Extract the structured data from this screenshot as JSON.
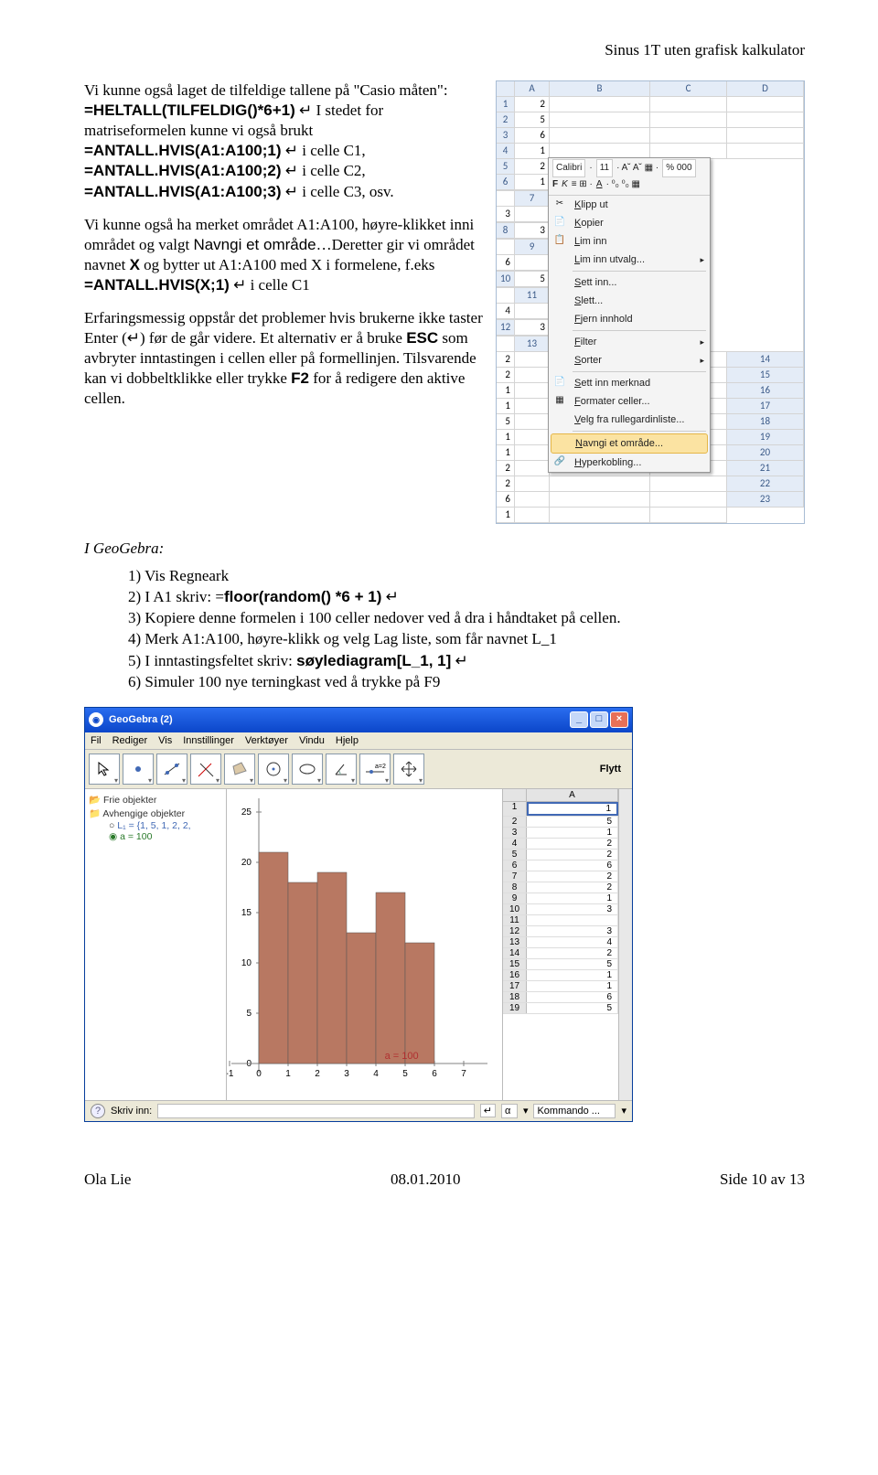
{
  "header": {
    "title": "Sinus 1T uten grafisk kalkulator"
  },
  "par1": {
    "a": "Vi kunne også laget de tilfeldige tallene på \"Casio måten\": ",
    "b": "=HELTALL(TILFELDIG()*6+1)",
    "c": " ↵",
    "d": "I stedet for matriseformelen kunne vi også brukt ",
    "e": "=ANTALL.HVIS(A1:A100;1)",
    "f": " ↵ i celle C1, ",
    "g": "=ANTALL.HVIS(A1:A100;2)",
    "h": " ↵ i celle C2, ",
    "i": "=ANTALL.HVIS(A1:A100;3)",
    "j": " ↵ i celle C3, osv."
  },
  "par2": {
    "a": "Vi kunne også ha merket området A1:A100, høyre-klikket inni området og valgt ",
    "b": "Navngi et område",
    "c": "…Deretter gir vi området navnet ",
    "d": "X",
    "e": " og bytter ut A1:A100 med X i formelene, f.eks ",
    "f": "=ANTALL.HVIS(X;1)",
    "g": " ↵ i celle C1"
  },
  "par3": {
    "a": "Erfaringsmessig oppstår det problemer hvis brukerne ikke taster Enter (↵) før de går videre. Et alternativ er å bruke ",
    "b": "ESC",
    "c": " som avbryter inntastingen i cellen eller på formellinjen. Tilsvarende kan vi dobbeltklikke eller trykke ",
    "d": "F2",
    "e": " for å redigere den aktive cellen."
  },
  "excel": {
    "cols": [
      "A",
      "B",
      "C",
      "D"
    ],
    "vals": [
      "2",
      "5",
      "6",
      "1",
      "2",
      "1",
      "3",
      "3",
      "6",
      "5",
      "4",
      "3",
      "2",
      "2",
      "1",
      "1",
      "5",
      "1",
      "1",
      "2",
      "2",
      "6",
      "1"
    ],
    "mini": {
      "font": "Calibri",
      "size": "11",
      "fmt": "% 000"
    },
    "menu": [
      "Klipp ut",
      "Kopier",
      "Lim inn",
      "Lim inn utvalg...",
      "Sett inn...",
      "Slett...",
      "Fjern innhold",
      "Filter",
      "Sorter",
      "Sett inn merknad",
      "Formater celler...",
      "Velg fra rullegardinliste...",
      "Navngi et område...",
      "Hyperkobling..."
    ]
  },
  "geo_h": "I GeoGebra:",
  "geo": [
    {
      "n": "1)",
      "a": "Vis Regneark"
    },
    {
      "n": "2)",
      "a": "I A1 skriv: =",
      "b": "floor(random() *6 + 1)",
      "c": " ↵"
    },
    {
      "n": "3)",
      "a": "Kopiere denne formelen i 100 celler nedover ved å dra i håndtaket på cellen."
    },
    {
      "n": "4)",
      "a": "Merk A1:A100, høyre-klikk og velg Lag liste, som får navnet L_1"
    },
    {
      "n": "5)",
      "a": "I inntastingsfeltet skriv: ",
      "b": "søylediagram[L_1, 1]",
      "c": " ↵"
    },
    {
      "n": "6)",
      "a": "Simuler 100 nye terningkast ved å trykke på F9"
    }
  ],
  "gg": {
    "title": "GeoGebra (2)",
    "menu": [
      "Fil",
      "Rediger",
      "Vis",
      "Innstillinger",
      "Verktøyer",
      "Vindu",
      "Hjelp"
    ],
    "flytt": "Flytt",
    "tree": {
      "f1": "Frie objekter",
      "f2": "Avhengige objekter",
      "l1": "L₁ = {1, 5, 1, 2, 2, ",
      "l2": "a = 100"
    },
    "axis_y": [
      "25",
      "20",
      "15",
      "10",
      "5",
      "0"
    ],
    "axis_x": [
      "-1",
      "0",
      "1",
      "2",
      "3",
      "4",
      "5",
      "6",
      "7"
    ],
    "ann": "a = 100",
    "sheet": {
      "col": "A",
      "vals": [
        "1",
        "5",
        "1",
        "2",
        "2",
        "6",
        "2",
        "2",
        "1",
        "3",
        "",
        "3",
        "4",
        "2",
        "5",
        "1",
        "1",
        "6",
        "5"
      ]
    },
    "status": {
      "lbl": "Skriv inn:",
      "alpha": "α",
      "cmd": "Kommando ..."
    }
  },
  "chart_data": {
    "type": "bar",
    "categories": [
      "1",
      "2",
      "3",
      "4",
      "5",
      "6"
    ],
    "values": [
      21,
      18,
      19,
      13,
      17,
      12
    ],
    "title": "",
    "xlabel": "",
    "ylabel": "",
    "xlim": [
      -1,
      7
    ],
    "ylim": [
      0,
      25
    ],
    "annotation": "a = 100"
  },
  "footer": {
    "a": "Ola Lie",
    "b": "08.01.2010",
    "c": "Side 10 av 13"
  }
}
